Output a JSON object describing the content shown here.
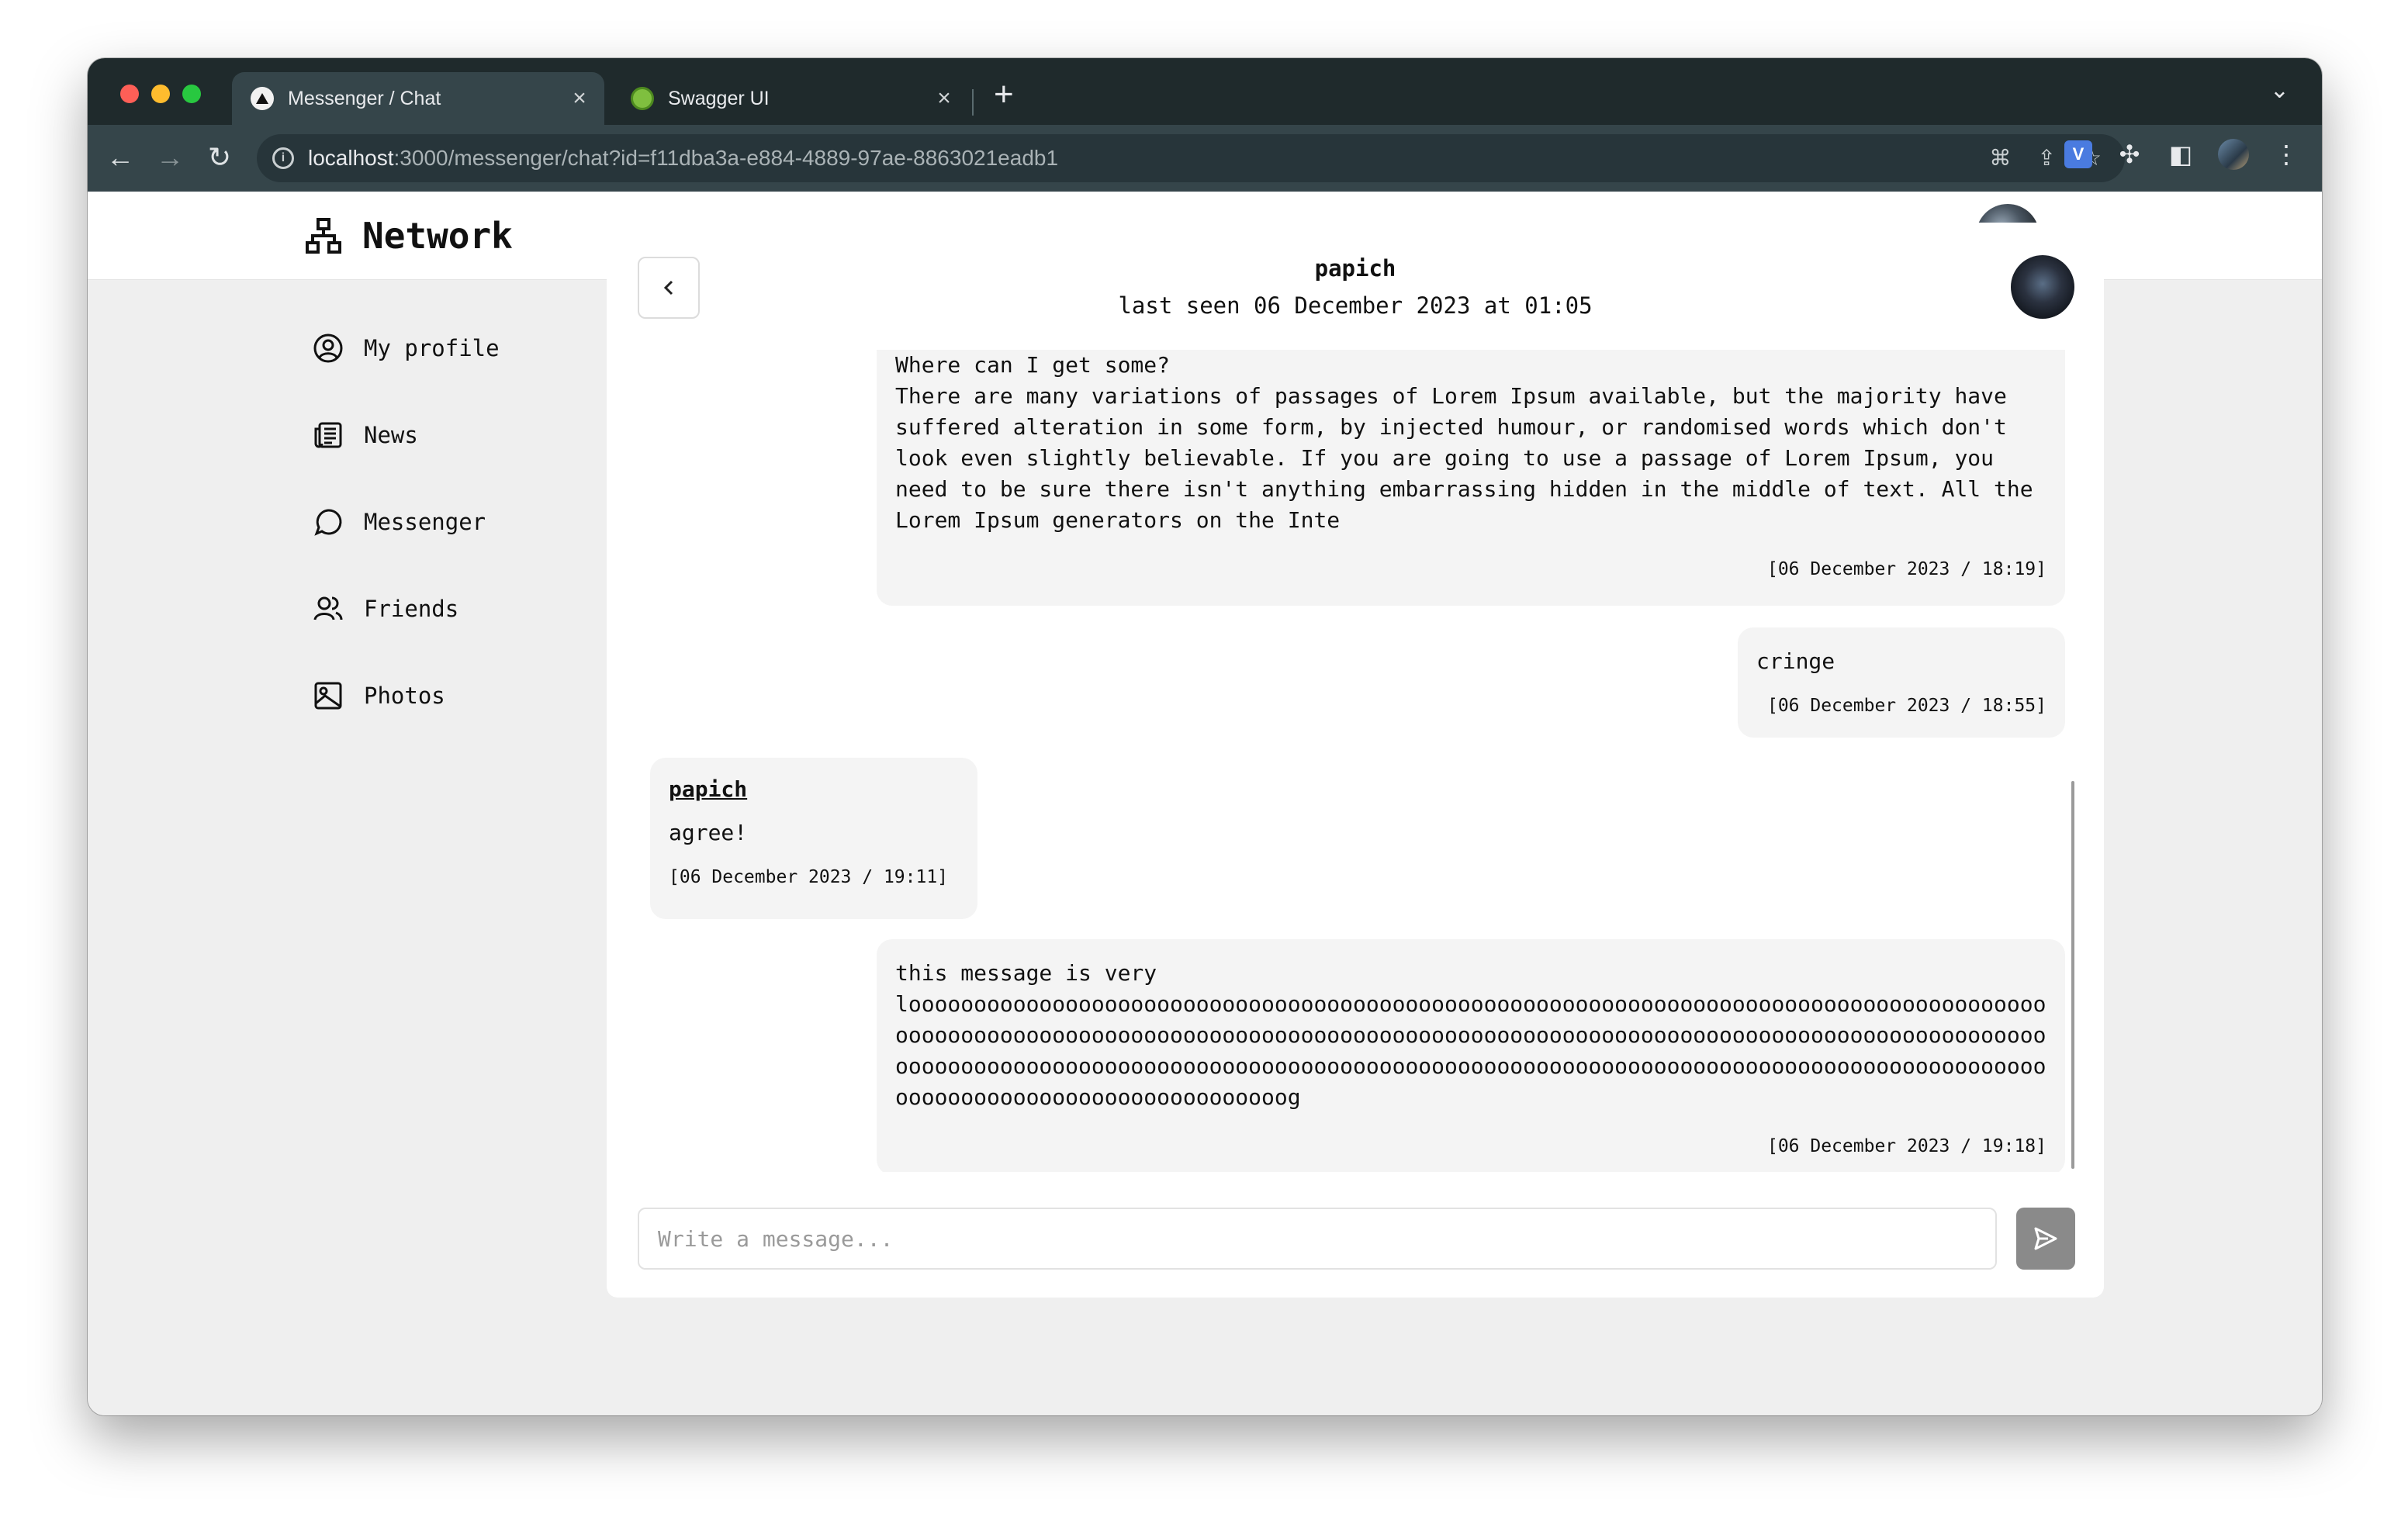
{
  "browser": {
    "tabs": [
      {
        "title": "Messenger / Chat",
        "active": true,
        "favicon": "triangle-logo-icon"
      },
      {
        "title": "Swagger UI",
        "active": false,
        "favicon": "swagger-globe-icon"
      }
    ],
    "url": {
      "host": "localhost",
      "path": ":3000/messenger/chat?id=f11dba3a-e884-4889-97ae-8863021eadb1"
    }
  },
  "app": {
    "brand": "Network",
    "sidebar": {
      "items": [
        {
          "label": "My profile",
          "icon": "user-circle-icon"
        },
        {
          "label": "News",
          "icon": "newspaper-icon"
        },
        {
          "label": "Messenger",
          "icon": "chat-bubble-icon"
        },
        {
          "label": "Friends",
          "icon": "users-icon"
        },
        {
          "label": "Photos",
          "icon": "image-icon"
        }
      ]
    },
    "chat": {
      "name": "papich",
      "last_seen": "last seen 06 December 2023 at 01:05",
      "messages": [
        {
          "text": "Where can I get some?\nThere are many variations of passages of Lorem Ipsum available, but the majority have suffered alteration in some form, by injected humour, or randomised words which don't look even slightly believable. If you are going to use a passage of Lorem Ipsum, you need to be sure there isn't anything embarrassing hidden in the middle of text. All the Lorem Ipsum generators on the Inte",
          "time": "[06 December 2023 / 18:19]"
        },
        {
          "text": "cringe",
          "time": "[06 December 2023 / 18:55]"
        },
        {
          "author": "papich",
          "text": "agree!",
          "time": "[06 December 2023 / 19:11]"
        },
        {
          "text": "this message is very\nlooooooooooooooooooooooooooooooooooooooooooooooooooooooooooooooooooooooooooooooooooooooooooooooooooooooooooooooooooooooooooooooooooooooooooooooooooooooooooooooooooooooooooooooooooooooooooooooooooooooooooooooooooooooooooooooooooooooooooooooooooooooooooooooooooooooooooooooooooooooooooooooooooooog",
          "time": "[06 December 2023 / 19:18]"
        }
      ],
      "composer_placeholder": "Write a message..."
    }
  }
}
